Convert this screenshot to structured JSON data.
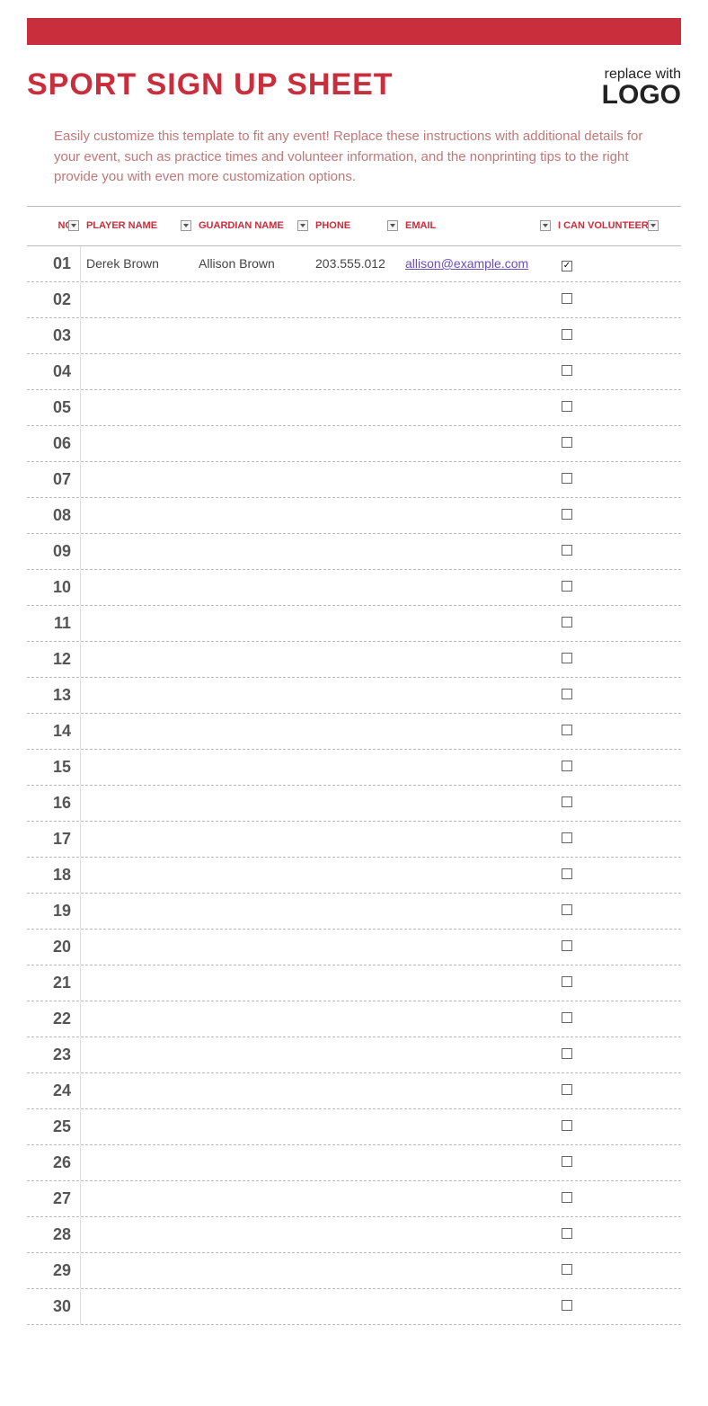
{
  "header": {
    "title": "SPORT SIGN UP SHEET",
    "logo_top": "replace with",
    "logo_bottom": "LOGO"
  },
  "instructions": "Easily customize this template to fit any event! Replace these instructions with additional details for your event, such as practice times and volunteer information, and the nonprinting tips to the right provide you with even more customization options.",
  "columns": {
    "no": "NO.",
    "player": "PLAYER NAME",
    "guardian": "GUARDIAN NAME",
    "phone": "PHONE",
    "email": "EMAIL",
    "volunteer": "I CAN VOLUNTEER"
  },
  "rows": [
    {
      "no": "01",
      "player": "Derek Brown",
      "guardian": "Allison Brown",
      "phone": "203.555.012",
      "email": "allison@example.com",
      "volunteer": true
    },
    {
      "no": "02",
      "player": "",
      "guardian": "",
      "phone": "",
      "email": "",
      "volunteer": false
    },
    {
      "no": "03",
      "player": "",
      "guardian": "",
      "phone": "",
      "email": "",
      "volunteer": false
    },
    {
      "no": "04",
      "player": "",
      "guardian": "",
      "phone": "",
      "email": "",
      "volunteer": false
    },
    {
      "no": "05",
      "player": "",
      "guardian": "",
      "phone": "",
      "email": "",
      "volunteer": false
    },
    {
      "no": "06",
      "player": "",
      "guardian": "",
      "phone": "",
      "email": "",
      "volunteer": false
    },
    {
      "no": "07",
      "player": "",
      "guardian": "",
      "phone": "",
      "email": "",
      "volunteer": false
    },
    {
      "no": "08",
      "player": "",
      "guardian": "",
      "phone": "",
      "email": "",
      "volunteer": false
    },
    {
      "no": "09",
      "player": "",
      "guardian": "",
      "phone": "",
      "email": "",
      "volunteer": false
    },
    {
      "no": "10",
      "player": "",
      "guardian": "",
      "phone": "",
      "email": "",
      "volunteer": false
    },
    {
      "no": "11",
      "player": "",
      "guardian": "",
      "phone": "",
      "email": "",
      "volunteer": false
    },
    {
      "no": "12",
      "player": "",
      "guardian": "",
      "phone": "",
      "email": "",
      "volunteer": false
    },
    {
      "no": "13",
      "player": "",
      "guardian": "",
      "phone": "",
      "email": "",
      "volunteer": false
    },
    {
      "no": "14",
      "player": "",
      "guardian": "",
      "phone": "",
      "email": "",
      "volunteer": false
    },
    {
      "no": "15",
      "player": "",
      "guardian": "",
      "phone": "",
      "email": "",
      "volunteer": false
    },
    {
      "no": "16",
      "player": "",
      "guardian": "",
      "phone": "",
      "email": "",
      "volunteer": false
    },
    {
      "no": "17",
      "player": "",
      "guardian": "",
      "phone": "",
      "email": "",
      "volunteer": false
    },
    {
      "no": "18",
      "player": "",
      "guardian": "",
      "phone": "",
      "email": "",
      "volunteer": false
    },
    {
      "no": "19",
      "player": "",
      "guardian": "",
      "phone": "",
      "email": "",
      "volunteer": false
    },
    {
      "no": "20",
      "player": "",
      "guardian": "",
      "phone": "",
      "email": "",
      "volunteer": false
    },
    {
      "no": "21",
      "player": "",
      "guardian": "",
      "phone": "",
      "email": "",
      "volunteer": false
    },
    {
      "no": "22",
      "player": "",
      "guardian": "",
      "phone": "",
      "email": "",
      "volunteer": false
    },
    {
      "no": "23",
      "player": "",
      "guardian": "",
      "phone": "",
      "email": "",
      "volunteer": false
    },
    {
      "no": "24",
      "player": "",
      "guardian": "",
      "phone": "",
      "email": "",
      "volunteer": false
    },
    {
      "no": "25",
      "player": "",
      "guardian": "",
      "phone": "",
      "email": "",
      "volunteer": false
    },
    {
      "no": "26",
      "player": "",
      "guardian": "",
      "phone": "",
      "email": "",
      "volunteer": false
    },
    {
      "no": "27",
      "player": "",
      "guardian": "",
      "phone": "",
      "email": "",
      "volunteer": false
    },
    {
      "no": "28",
      "player": "",
      "guardian": "",
      "phone": "",
      "email": "",
      "volunteer": false
    },
    {
      "no": "29",
      "player": "",
      "guardian": "",
      "phone": "",
      "email": "",
      "volunteer": false
    },
    {
      "no": "30",
      "player": "",
      "guardian": "",
      "phone": "",
      "email": "",
      "volunteer": false
    }
  ]
}
